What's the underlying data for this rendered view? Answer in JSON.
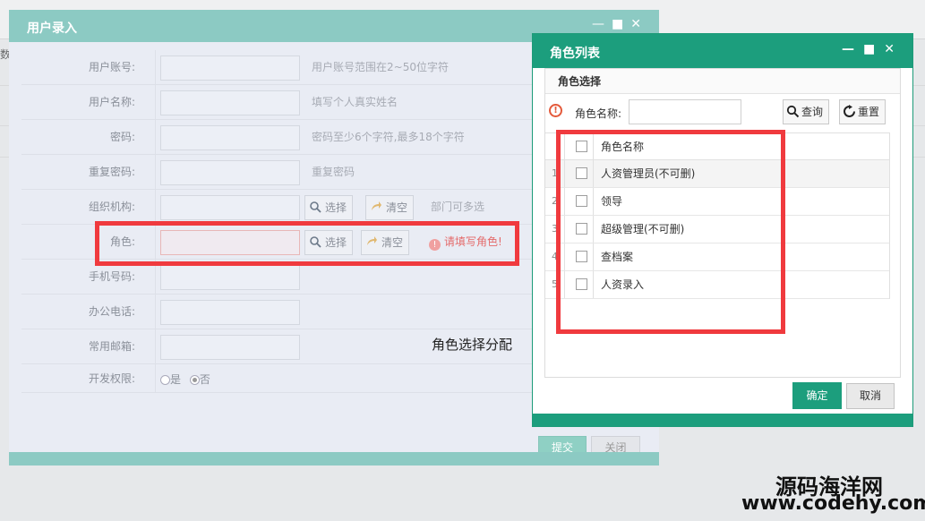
{
  "background": {
    "crumb": "数"
  },
  "user_dialog": {
    "title": "用户录入",
    "fields": [
      {
        "label": "用户账号:",
        "hint": "用户账号范围在2~50位字符"
      },
      {
        "label": "用户名称:",
        "hint": "填写个人真实姓名"
      },
      {
        "label": "密码:",
        "hint": "密码至少6个字符,最多18个字符"
      },
      {
        "label": "重复密码:",
        "hint": "重复密码"
      },
      {
        "label": "组织机构:",
        "select_label": "选择",
        "clear_label": "清空",
        "hint": "部门可多选"
      },
      {
        "label": "角色:",
        "select_label": "选择",
        "clear_label": "清空",
        "error": "请填写角色!"
      },
      {
        "label": "手机号码:"
      },
      {
        "label": "办公电话:"
      },
      {
        "label": "常用邮箱:"
      },
      {
        "label": "开发权限:",
        "options": [
          "是",
          "否"
        ],
        "selected": "否"
      }
    ],
    "submit_label": "提交",
    "close_label": "关闭"
  },
  "annotation": "角色选择分配",
  "role_dialog": {
    "title": "角色列表",
    "panel_title": "角色选择",
    "search_label": "角色名称:",
    "search_value": "",
    "query_label": "查询",
    "reset_label": "重置",
    "column_header": "角色名称",
    "rows": [
      {
        "num": "1",
        "name": "人资管理员(不可删)"
      },
      {
        "num": "2",
        "name": "领导"
      },
      {
        "num": "3",
        "name": "超级管理(不可删)"
      },
      {
        "num": "4",
        "name": "查档案"
      },
      {
        "num": "5",
        "name": "人资录入"
      }
    ],
    "ok_label": "确定",
    "cancel_label": "取消"
  },
  "watermark": {
    "line1": "源码海洋网",
    "line2": "www.codehy.com"
  },
  "colors": {
    "role_accent": "#1c9e7d",
    "user_accent": "#8ccac3",
    "highlight": "#f03a3e"
  }
}
